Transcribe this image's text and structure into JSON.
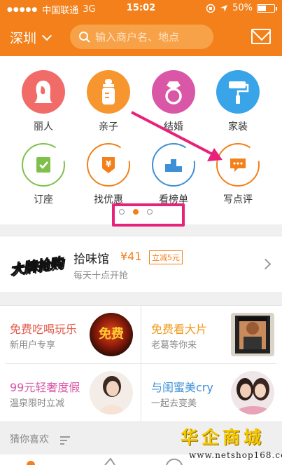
{
  "status_bar": {
    "carrier": "中国联通",
    "network": "3G",
    "time": "15:02",
    "battery": "50%"
  },
  "header": {
    "city": "深圳",
    "search_placeholder": "输入商户名、地点"
  },
  "categories": [
    {
      "label": "丽人",
      "color": "#f16c68"
    },
    {
      "label": "亲子",
      "color": "#f7962f"
    },
    {
      "label": "结婚",
      "color": "#d957a6"
    },
    {
      "label": "家装",
      "color": "#39a4e8"
    },
    {
      "label": "订座",
      "color": "#80c04a"
    },
    {
      "label": "找优惠",
      "color": "#f3801a"
    },
    {
      "label": "看榜单",
      "color": "#3d8fd6"
    },
    {
      "label": "写点评",
      "color": "#f3801a"
    }
  ],
  "pager": {
    "pages": 3,
    "current": 2
  },
  "deal": {
    "logo_text": "大牌抢购",
    "name": "拾味馆",
    "price": "¥41",
    "badge": "立减5元",
    "subtitle": "每天十点开抢"
  },
  "promos": [
    {
      "title": "免费吃喝玩乐",
      "subtitle": "新用户专享",
      "title_color": "#e25b4b"
    },
    {
      "title": "免费看大片",
      "subtitle": "老葛等你来",
      "title_color": "#f29a1a"
    },
    {
      "title": "99元轻奢度假",
      "subtitle": "温泉限时立减",
      "title_color": "#d957a6"
    },
    {
      "title": "与闺蜜美cry",
      "subtitle": "一起去变美",
      "title_color": "#3d8fd6"
    }
  ],
  "promo_badge_text": "免费",
  "section": {
    "guess_title": "猜你喜欢"
  },
  "watermark": {
    "brand": "华企商城",
    "url": "www.netshop168.com"
  },
  "colors": {
    "brand_orange": "#f3801a",
    "annotation_pink": "#e8217a"
  }
}
